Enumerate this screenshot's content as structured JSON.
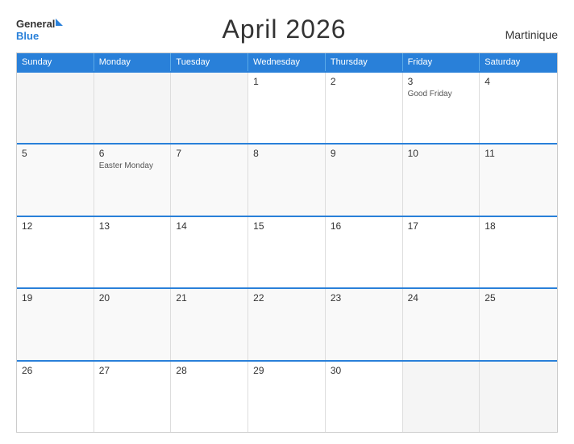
{
  "header": {
    "title": "April 2026",
    "region": "Martinique",
    "logo_general": "General",
    "logo_blue": "Blue"
  },
  "day_headers": [
    "Sunday",
    "Monday",
    "Tuesday",
    "Wednesday",
    "Thursday",
    "Friday",
    "Saturday"
  ],
  "weeks": [
    [
      {
        "num": "",
        "holiday": "",
        "empty": true
      },
      {
        "num": "",
        "holiday": "",
        "empty": true
      },
      {
        "num": "",
        "holiday": "",
        "empty": true
      },
      {
        "num": "1",
        "holiday": ""
      },
      {
        "num": "2",
        "holiday": ""
      },
      {
        "num": "3",
        "holiday": "Good Friday"
      },
      {
        "num": "4",
        "holiday": ""
      }
    ],
    [
      {
        "num": "5",
        "holiday": ""
      },
      {
        "num": "6",
        "holiday": "Easter Monday"
      },
      {
        "num": "7",
        "holiday": ""
      },
      {
        "num": "8",
        "holiday": ""
      },
      {
        "num": "9",
        "holiday": ""
      },
      {
        "num": "10",
        "holiday": ""
      },
      {
        "num": "11",
        "holiday": ""
      }
    ],
    [
      {
        "num": "12",
        "holiday": ""
      },
      {
        "num": "13",
        "holiday": ""
      },
      {
        "num": "14",
        "holiday": ""
      },
      {
        "num": "15",
        "holiday": ""
      },
      {
        "num": "16",
        "holiday": ""
      },
      {
        "num": "17",
        "holiday": ""
      },
      {
        "num": "18",
        "holiday": ""
      }
    ],
    [
      {
        "num": "19",
        "holiday": ""
      },
      {
        "num": "20",
        "holiday": ""
      },
      {
        "num": "21",
        "holiday": ""
      },
      {
        "num": "22",
        "holiday": ""
      },
      {
        "num": "23",
        "holiday": ""
      },
      {
        "num": "24",
        "holiday": ""
      },
      {
        "num": "25",
        "holiday": ""
      }
    ],
    [
      {
        "num": "26",
        "holiday": ""
      },
      {
        "num": "27",
        "holiday": ""
      },
      {
        "num": "28",
        "holiday": ""
      },
      {
        "num": "29",
        "holiday": ""
      },
      {
        "num": "30",
        "holiday": ""
      },
      {
        "num": "",
        "holiday": "",
        "empty": true
      },
      {
        "num": "",
        "holiday": "",
        "empty": true
      }
    ]
  ],
  "colors": {
    "header_bg": "#2980d9",
    "accent": "#2980d9"
  }
}
